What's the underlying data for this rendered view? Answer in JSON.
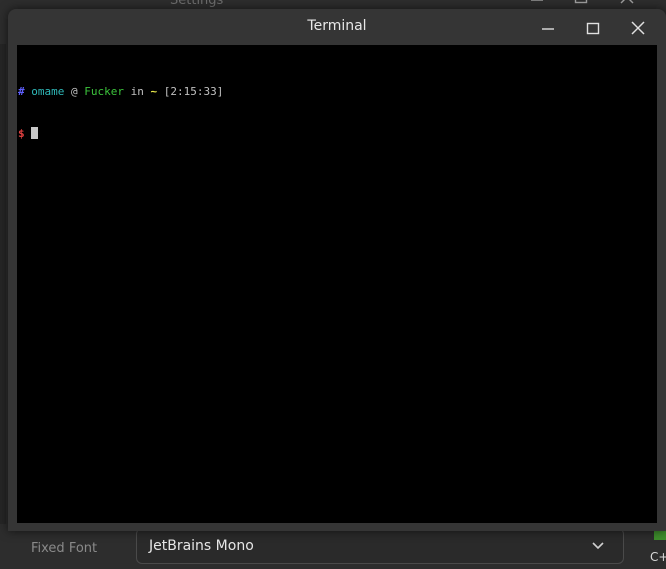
{
  "background_window": {
    "title": "Settings",
    "fixed_font_label": "Fixed Font",
    "fixed_font_value": "JetBrains Mono",
    "clipped_text": "C+"
  },
  "terminal": {
    "title": "Terminal",
    "prompt": {
      "hash": "#",
      "user": "omame",
      "at": "@",
      "host": "Fucker",
      "in": "in",
      "dir": "~",
      "time": "[2:15:33]",
      "dollar": "$"
    }
  },
  "colors": {
    "hash": "#5f5fff",
    "user": "#2fb8b8",
    "at": "#c0c0c0",
    "host": "#3cc43c",
    "in": "#c0c0c0",
    "dir": "#e8e84a",
    "time": "#c0c0c0",
    "dollar": "#e04040"
  }
}
